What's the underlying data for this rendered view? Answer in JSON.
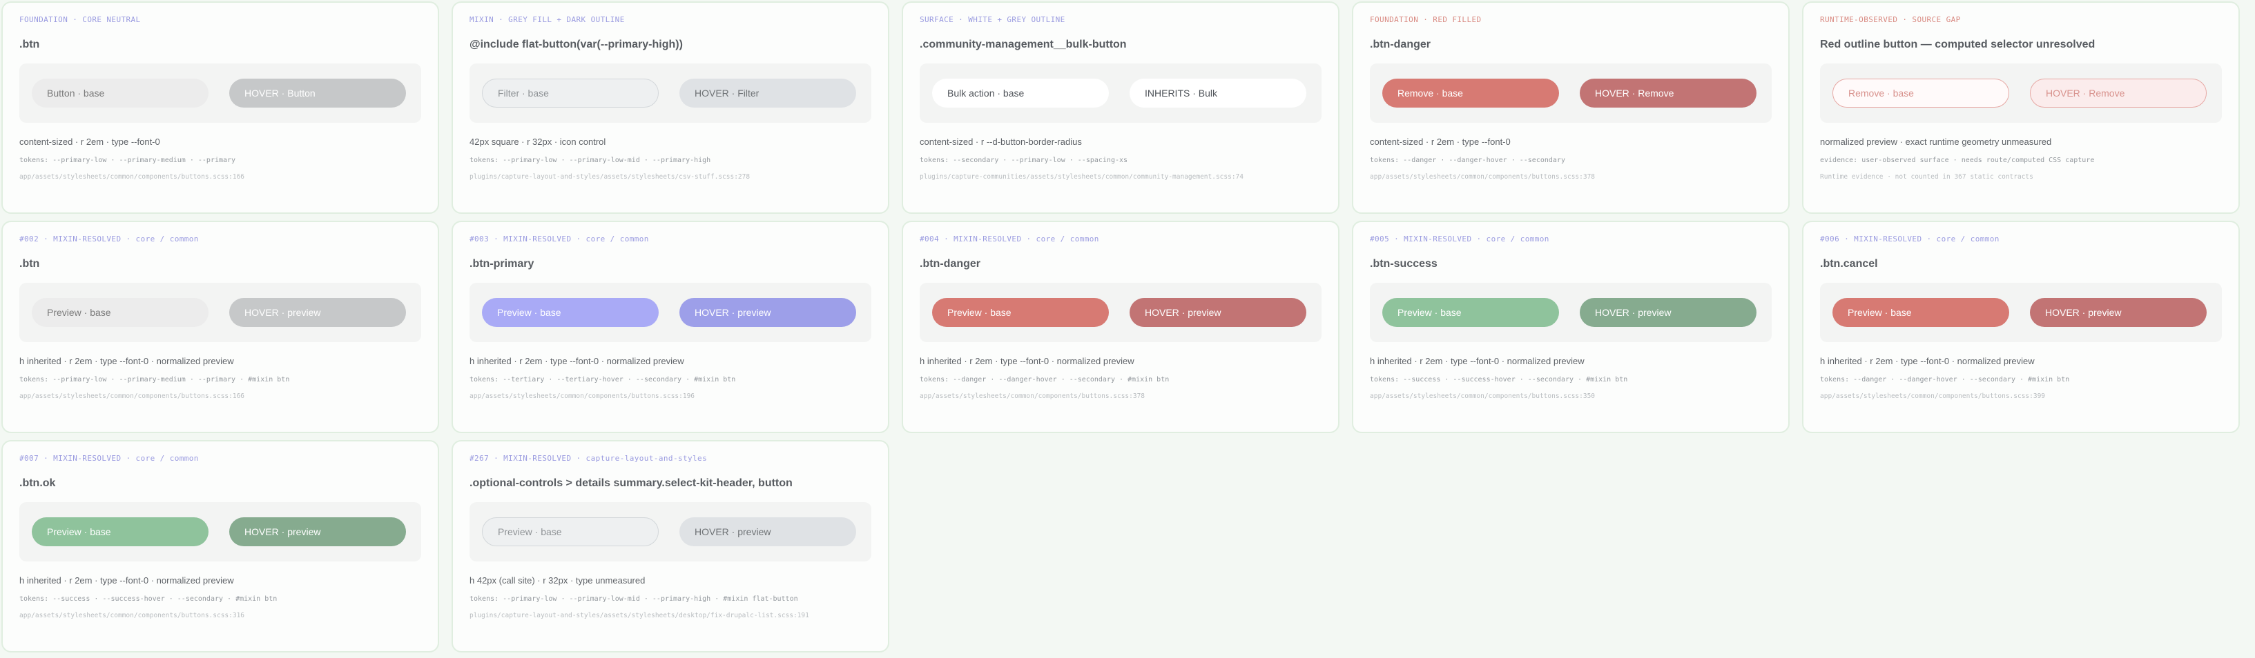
{
  "cards": [
    {
      "tag": "FOUNDATION · CORE NEUTRAL",
      "title": ".btn",
      "base": "Button · base",
      "hover": "HOVER · Button",
      "meta": "content-sized · r 2em · type --font-0",
      "tokens": "tokens: --primary-low · --primary-medium · --primary",
      "path": "app/assets/stylesheets/common/components/buttons.scss:166"
    },
    {
      "tag": "MIXIN · GREY FILL + DARK OUTLINE",
      "title": "@include flat-button(var(--primary-high))",
      "base": "Filter · base",
      "hover": "HOVER · Filter",
      "meta": "42px square · r 32px · icon control",
      "tokens": "tokens: --primary-low · --primary-low-mid · --primary-high",
      "path": "plugins/capture-layout-and-styles/assets/stylesheets/csv-stuff.scss:278"
    },
    {
      "tag": "SURFACE · WHITE + GREY OUTLINE",
      "title": ".community-management__bulk-button",
      "base": "Bulk action · base",
      "hover": "INHERITS · Bulk",
      "meta": "content-sized · r --d-button-border-radius",
      "tokens": "tokens: --secondary · --primary-low · --spacing-xs",
      "path": "plugins/capture-communities/assets/stylesheets/common/community-management.scss:74"
    },
    {
      "tag": "FOUNDATION · RED FILLED",
      "title": ".btn-danger",
      "base": "Remove · base",
      "hover": "HOVER · Remove",
      "meta": "content-sized · r 2em · type --font-0",
      "tokens": "tokens: --danger · --danger-hover · --secondary",
      "path": "app/assets/stylesheets/common/components/buttons.scss:378"
    },
    {
      "tag": "RUNTIME-OBSERVED · SOURCE GAP",
      "title": "Red outline button — computed selector unresolved",
      "base": "Remove · base",
      "hover": "HOVER · Remove",
      "meta": "normalized preview · exact runtime geometry unmeasured",
      "tokens": "evidence: user-observed surface · needs route/computed CSS capture",
      "path": "Runtime evidence · not counted in 367 static contracts"
    },
    {
      "tag": "#002 · MIXIN-RESOLVED · core / common",
      "title": ".btn",
      "base": "Preview · base",
      "hover": "HOVER · preview",
      "meta": "h inherited · r 2em · type --font-0 · normalized preview",
      "tokens": "tokens: --primary-low · --primary-medium · --primary · #mixin btn",
      "path": "app/assets/stylesheets/common/components/buttons.scss:166"
    },
    {
      "tag": "#003 · MIXIN-RESOLVED · core / common",
      "title": ".btn-primary",
      "base": "Preview · base",
      "hover": "HOVER · preview",
      "meta": "h inherited · r 2em · type --font-0 · normalized preview",
      "tokens": "tokens: --tertiary · --tertiary-hover · --secondary · #mixin btn",
      "path": "app/assets/stylesheets/common/components/buttons.scss:196"
    },
    {
      "tag": "#004 · MIXIN-RESOLVED · core / common",
      "title": ".btn-danger",
      "base": "Preview · base",
      "hover": "HOVER · preview",
      "meta": "h inherited · r 2em · type --font-0 · normalized preview",
      "tokens": "tokens: --danger · --danger-hover · --secondary · #mixin btn",
      "path": "app/assets/stylesheets/common/components/buttons.scss:378"
    },
    {
      "tag": "#005 · MIXIN-RESOLVED · core / common",
      "title": ".btn-success",
      "base": "Preview · base",
      "hover": "HOVER · preview",
      "meta": "h inherited · r 2em · type --font-0 · normalized preview",
      "tokens": "tokens: --success · --success-hover · --secondary · #mixin btn",
      "path": "app/assets/stylesheets/common/components/buttons.scss:350"
    },
    {
      "tag": "#006 · MIXIN-RESOLVED · core / common",
      "title": ".btn.cancel",
      "base": "Preview · base",
      "hover": "HOVER · preview",
      "meta": "h inherited · r 2em · type --font-0 · normalized preview",
      "tokens": "tokens: --danger · --danger-hover · --secondary · #mixin btn",
      "path": "app/assets/stylesheets/common/components/buttons.scss:399"
    },
    {
      "tag": "#007 · MIXIN-RESOLVED · core / common",
      "title": ".btn.ok",
      "base": "Preview · base",
      "hover": "HOVER · preview",
      "meta": "h inherited · r 2em · type --font-0 · normalized preview",
      "tokens": "tokens: --success · --success-hover · --secondary · #mixin btn",
      "path": "app/assets/stylesheets/common/components/buttons.scss:316"
    },
    {
      "tag": "#267 · MIXIN-RESOLVED · capture-layout-and-styles",
      "title": ".optional-controls > details summary.select-kit-header, button",
      "base": "Preview · base",
      "hover": "HOVER · preview",
      "meta": "h 42px (call site) · r 32px · type unmeasured",
      "tokens": "tokens: --primary-low · --primary-low-mid · --primary-high · #mixin flat-button",
      "path": "plugins/capture-layout-and-styles/assets/stylesheets/desktop/fix-drupalc-list.scss:191"
    }
  ]
}
